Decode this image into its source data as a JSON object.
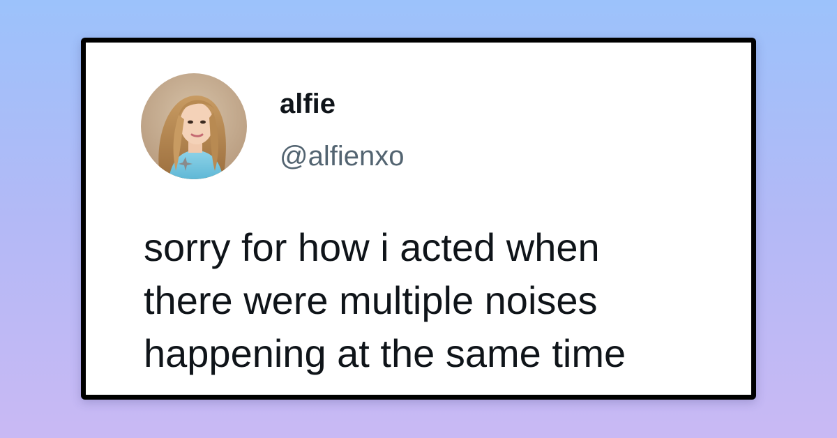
{
  "tweet": {
    "display_name": "alfie",
    "handle": "@alfienxo",
    "text_lines": [
      "sorry for how i acted when",
      "there were multiple noises",
      "happening at the same time"
    ]
  },
  "colors": {
    "background_top": "#9cc2fb",
    "background_bottom": "#c9b9f4",
    "card_background": "#ffffff",
    "card_border": "#000000",
    "handle_text": "#536471",
    "body_text": "#0f1419"
  }
}
